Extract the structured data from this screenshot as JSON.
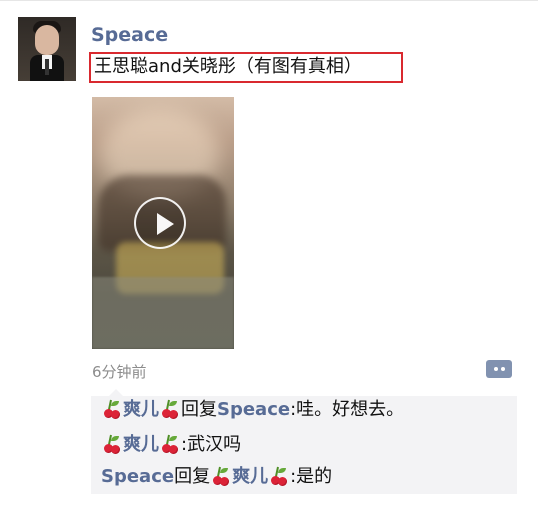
{
  "post": {
    "author": "Speace",
    "content": "王思聪and关晓彤（有图有真相）",
    "time": "6分钟前"
  },
  "comments": [
    {
      "user": "爽儿",
      "separator": ": ",
      "text": "武汉吗"
    },
    {
      "speaker": "Speace",
      "reply_word": "回复",
      "target": "爽儿",
      "separator": ": ",
      "text": "是的"
    },
    {
      "user": "爽儿",
      "reply_word": " 回复",
      "target": "Speace",
      "separator": ": ",
      "text": "哇。好想去。"
    }
  ],
  "icons": {
    "avatar": "profile-photo",
    "video_play": "play-icon",
    "comment_action": "more-icon",
    "cherry": "cherry-icon"
  },
  "colors": {
    "username": "#576b95",
    "highlight_border": "#d9292f",
    "comment_background": "#f3f3f5"
  }
}
